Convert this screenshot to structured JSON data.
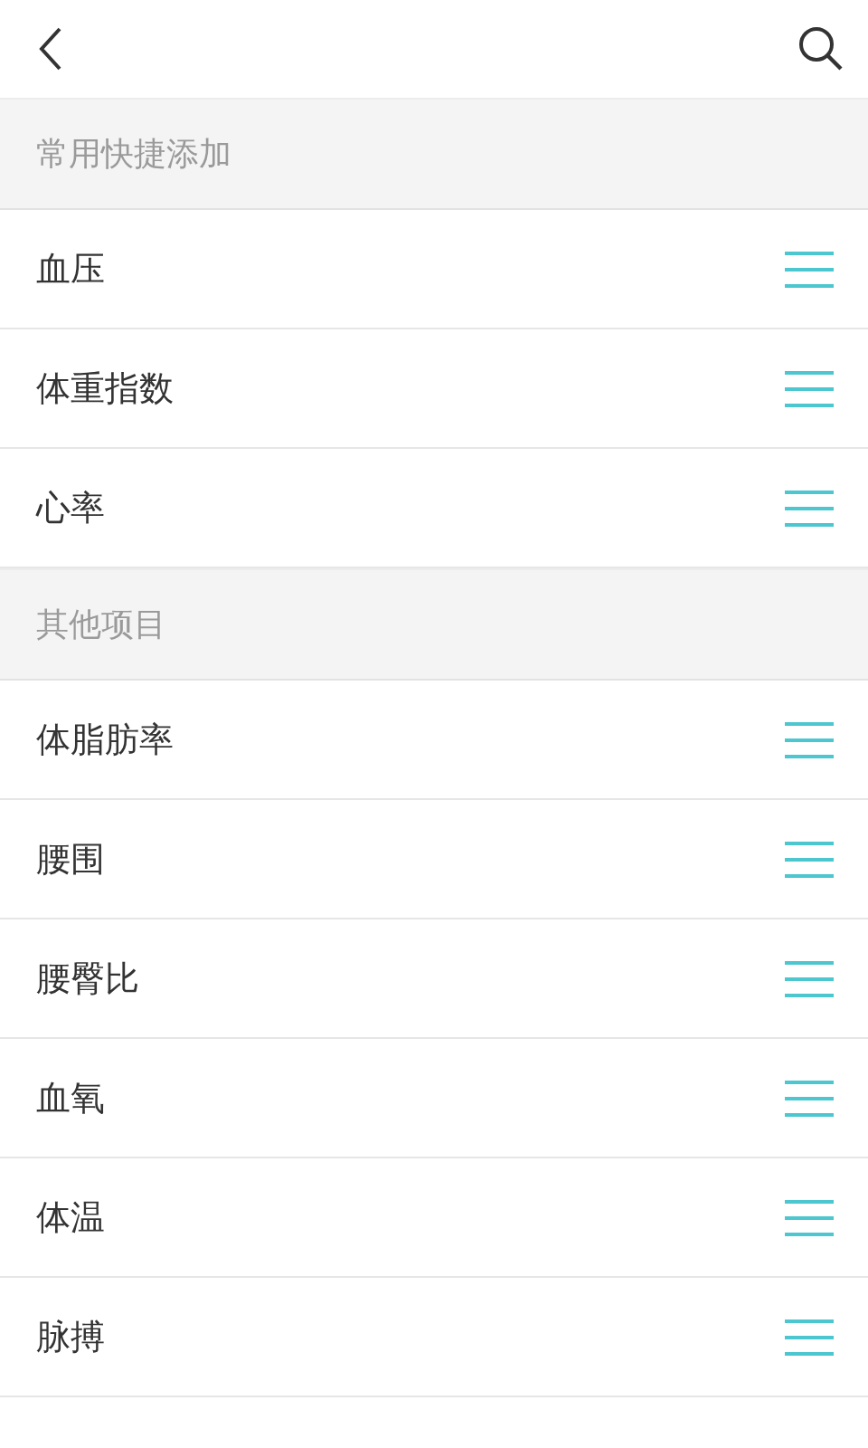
{
  "sections": [
    {
      "title": "常用快捷添加",
      "items": [
        {
          "label": "血压"
        },
        {
          "label": "体重指数"
        },
        {
          "label": "心率"
        }
      ]
    },
    {
      "title": "其他项目",
      "items": [
        {
          "label": "体脂肪率"
        },
        {
          "label": "腰围"
        },
        {
          "label": "腰臀比"
        },
        {
          "label": "血氧"
        },
        {
          "label": "体温"
        },
        {
          "label": "脉搏"
        }
      ]
    }
  ]
}
